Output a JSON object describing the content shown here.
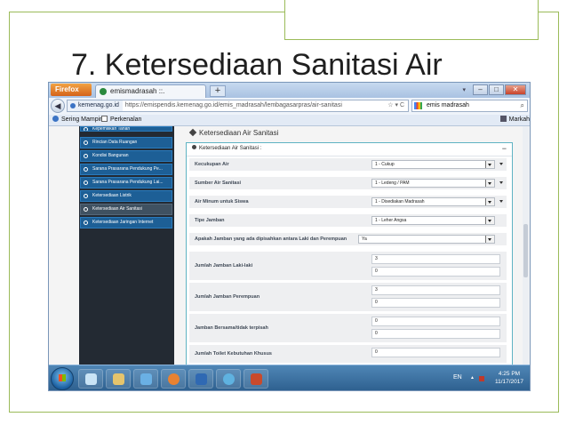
{
  "slide": {
    "title": "7. Ketersediaan Sanitasi Air"
  },
  "browser": {
    "app_button": "Firefox",
    "tab_title": "emismadrasah ::.",
    "new_tab_symbol": "+",
    "ghost_title": "",
    "url_site": "kemenag.go.id",
    "url_text": "https://emispendis.kemenag.go.id/emis_madrasah/lembagasarpras/air-sanitasi",
    "search_value": "emis madrasah",
    "bookmarks": [
      "Sering Mampir",
      "Perkenalan"
    ],
    "bookmarks_menu": "Markah"
  },
  "sidebar": {
    "items": [
      {
        "label": "Kepemilikan Tanah",
        "active": false
      },
      {
        "label": "Rincian Data Ruangan",
        "active": false
      },
      {
        "label": "Kondisi Bangunan",
        "active": false
      },
      {
        "label": "Sarana Prasarana Pendukung Pe...",
        "active": false
      },
      {
        "label": "Sarana Prasarana Pendukung Lai...",
        "active": false
      },
      {
        "label": "Ketersediaan Listrik",
        "active": false
      },
      {
        "label": "Ketersediaan Air Sanitasi",
        "active": true
      },
      {
        "label": "Ketersediaan Jaringan Internet",
        "active": false
      }
    ]
  },
  "content": {
    "page_heading": "Ketersediaan Air Sanitasi",
    "panel_title": "Ketersediaan Air Sanitasi :",
    "collapse_symbol": "−",
    "selects": [
      {
        "label": "Kecukupan Air",
        "value": "1 - Cukup"
      },
      {
        "label": "Sumber Air Sanitasi",
        "value": "1 - Ledeng / PAM"
      },
      {
        "label": "Air Minum untuk Siswa",
        "value": "1 - Disediakan Madrasah"
      },
      {
        "label": "Tipe Jamban",
        "value": "1 - Leher Angsa"
      },
      {
        "label": "Apakah Jamban yang ada dipisahkan antara Laki dan Perempuan",
        "value": "Ya"
      }
    ],
    "groups": [
      {
        "label": "Jumlah Jamban Laki-laki",
        "values": [
          "3",
          "0"
        ]
      },
      {
        "label": "Jumlah Jamban Perempuan",
        "values": [
          "3",
          "0"
        ]
      },
      {
        "label": "Jamban Bersama/tidak terpisah",
        "values": [
          "0",
          "0"
        ]
      },
      {
        "label": "Jumlah Toilet Kebutuhan Khusus",
        "values": [
          "0"
        ]
      }
    ]
  },
  "taskbar": {
    "language": "EN",
    "time": "4:25 PM",
    "date": "11/17/2017"
  }
}
